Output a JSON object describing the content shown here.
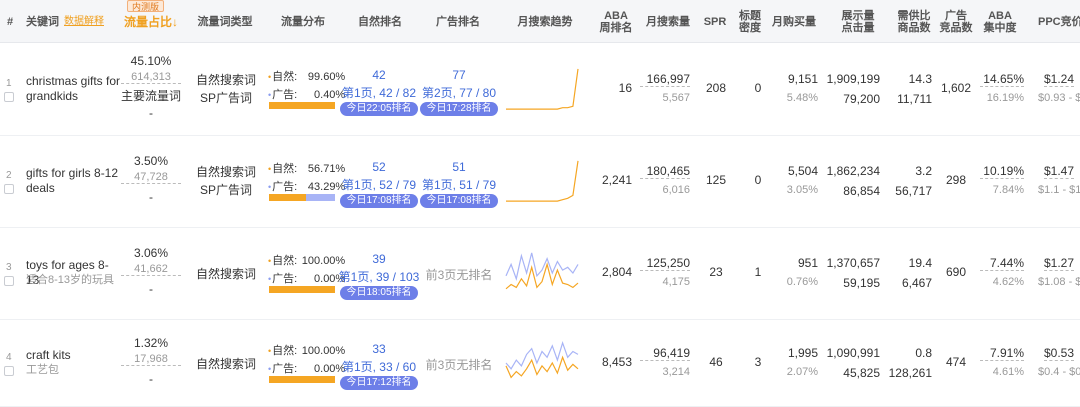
{
  "headers": {
    "idx": "#",
    "keyword": "关键词",
    "data_explain": "数据解释",
    "beta": "内测版",
    "traffic_share": "流量占比↓",
    "traffic_type": "流量词类型",
    "traffic_dist": "流量分布",
    "organic_rank": "自然排名",
    "ad_rank": "广告排名",
    "trend": "月搜索趋势",
    "aba_rank": "ABA\n周排名",
    "monthly_search": "月搜索量",
    "spr": "SPR",
    "title_density": "标题\n密度",
    "monthly_buy": "月购买量",
    "impressions": "展示量\n点击量",
    "supply_demand": "需供比\n商品数",
    "ad_competitors": "广告\n竞品数",
    "aba_concentration": "ABA\n集中度",
    "ppc": "PPC竞价"
  },
  "rows": [
    {
      "index": "1",
      "keyword": "christmas gifts for grandkids",
      "keyword_sub": "",
      "share_pct": "45.10%",
      "share_count": "614,313",
      "main_traffic": "主要流量词",
      "dash": "-",
      "types": [
        "自然搜索词",
        "SP广告词"
      ],
      "organic_label": "自然:",
      "organic_pct": "99.60%",
      "ad_label": "广告:",
      "ad_pct": "0.40%",
      "organic_share": 0.996,
      "organic_rank_num": "42",
      "organic_rank_text": "第1页, 42 / 82",
      "organic_rank_time": "今日22:05排名",
      "ad_rank_num": "77",
      "ad_rank_text": "第2页, 77 / 80",
      "ad_rank_time": "今日17:28排名",
      "aba": "16",
      "monthly_search": "166,997",
      "monthly_search_sub": "5,567",
      "spr": "208",
      "density": "0",
      "monthly_buy": "9,151",
      "monthly_buy_pct": "5.48%",
      "impressions": "1,909,199",
      "clicks": "79,200",
      "sd_ratio": "14.3",
      "products": "11,711",
      "ad_comp": "1,602",
      "concentration": "14.65%",
      "concentration_sub": "16.19%",
      "ppc": "$1.24",
      "ppc_range": "$0.93 - $1"
    },
    {
      "index": "2",
      "keyword": "gifts for girls 8-12 deals",
      "keyword_sub": "",
      "share_pct": "3.50%",
      "share_count": "47,728",
      "main_traffic": "",
      "dash": "-",
      "types": [
        "自然搜索词",
        "SP广告词"
      ],
      "organic_label": "自然:",
      "organic_pct": "56.71%",
      "ad_label": "广告:",
      "ad_pct": "43.29%",
      "organic_share": 0.5671,
      "organic_rank_num": "52",
      "organic_rank_text": "第1页, 52 / 79",
      "organic_rank_time": "今日17:08排名",
      "ad_rank_num": "51",
      "ad_rank_text": "第1页, 51 / 79",
      "ad_rank_time": "今日17:08排名",
      "aba": "2,241",
      "monthly_search": "180,465",
      "monthly_search_sub": "6,016",
      "spr": "125",
      "density": "0",
      "monthly_buy": "5,504",
      "monthly_buy_pct": "3.05%",
      "impressions": "1,862,234",
      "clicks": "86,854",
      "sd_ratio": "3.2",
      "products": "56,717",
      "ad_comp": "298",
      "concentration": "10.19%",
      "concentration_sub": "7.84%",
      "ppc": "$1.47",
      "ppc_range": "$1.1 - $1.8"
    },
    {
      "index": "3",
      "keyword": "toys for ages 8-13",
      "keyword_sub": "适合8-13岁的玩具",
      "share_pct": "3.06%",
      "share_count": "41,662",
      "main_traffic": "",
      "dash": "-",
      "types": [
        "自然搜索词"
      ],
      "organic_label": "自然:",
      "organic_pct": "100.00%",
      "ad_label": "广告:",
      "ad_pct": "0.00%",
      "organic_share": 1.0,
      "organic_rank_num": "39",
      "organic_rank_text": "第1页, 39 / 103",
      "organic_rank_time": "今日18:05排名",
      "ad_rank_num": "",
      "ad_rank_text": "前3页无排名",
      "ad_rank_time": "",
      "aba": "2,804",
      "monthly_search": "125,250",
      "monthly_search_sub": "4,175",
      "spr": "23",
      "density": "1",
      "monthly_buy": "951",
      "monthly_buy_pct": "0.76%",
      "impressions": "1,370,657",
      "clicks": "59,195",
      "sd_ratio": "19.4",
      "products": "6,467",
      "ad_comp": "690",
      "concentration": "7.44%",
      "concentration_sub": "4.62%",
      "ppc": "$1.27",
      "ppc_range": "$1.08 - $1"
    },
    {
      "index": "4",
      "keyword": "craft kits",
      "keyword_sub": "工艺包",
      "share_pct": "1.32%",
      "share_count": "17,968",
      "main_traffic": "",
      "dash": "-",
      "types": [
        "自然搜索词"
      ],
      "organic_label": "自然:",
      "organic_pct": "100.00%",
      "ad_label": "广告:",
      "ad_pct": "0.00%",
      "organic_share": 1.0,
      "organic_rank_num": "33",
      "organic_rank_text": "第1页, 33 / 60",
      "organic_rank_time": "今日17:12排名",
      "ad_rank_num": "",
      "ad_rank_text": "前3页无排名",
      "ad_rank_time": "",
      "aba": "8,453",
      "monthly_search": "96,419",
      "monthly_search_sub": "3,214",
      "spr": "46",
      "density": "3",
      "monthly_buy": "1,995",
      "monthly_buy_pct": "2.07%",
      "impressions": "1,090,991",
      "clicks": "45,825",
      "sd_ratio": "0.8",
      "products": "128,261",
      "ad_comp": "474",
      "concentration": "7.91%",
      "concentration_sub": "4.61%",
      "ppc": "$0.53",
      "ppc_range": "$0.4 - $0."
    }
  ],
  "sparklines": [
    {
      "orange": [
        2,
        2,
        2,
        2,
        2,
        2,
        2,
        2,
        2,
        2,
        2,
        3,
        3,
        4,
        30
      ],
      "blue": []
    },
    {
      "orange": [
        2,
        2,
        2,
        2,
        2,
        2,
        2,
        2,
        2,
        2,
        2,
        3,
        4,
        6,
        30
      ],
      "blue": []
    },
    {
      "orange": [
        5,
        8,
        6,
        12,
        7,
        20,
        6,
        10,
        22,
        8,
        18,
        9,
        8,
        6,
        9
      ],
      "blue": [
        14,
        22,
        12,
        28,
        16,
        30,
        14,
        18,
        26,
        16,
        24,
        18,
        20,
        16,
        22
      ]
    },
    {
      "orange": [
        14,
        6,
        10,
        7,
        12,
        18,
        8,
        14,
        10,
        16,
        9,
        20,
        11,
        15,
        12
      ],
      "blue": [
        16,
        12,
        18,
        14,
        22,
        26,
        16,
        24,
        20,
        28,
        18,
        30,
        20,
        24,
        22
      ]
    }
  ],
  "colors": {
    "accent_orange": "#f5a623",
    "accent_blue": "#a8b4f6",
    "pill_purple": "#6d7fe8",
    "link_blue": "#3f6ad8"
  }
}
